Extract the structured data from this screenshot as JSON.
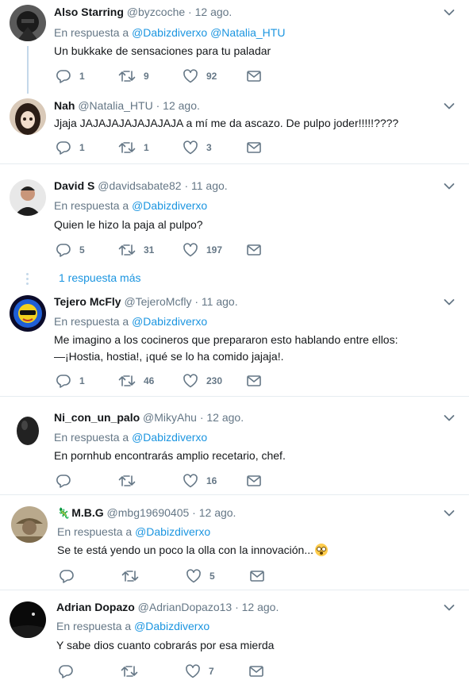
{
  "reply_prefix": "En respuesta a",
  "tweets": [
    {
      "name": "Also Starring",
      "handle": "@byzcoche",
      "time": "12 ago.",
      "reply_to": [
        "@Dabizdiverxo",
        "@Natalia_HTU"
      ],
      "text": "Un bukkake de sensaciones para tu paladar",
      "replies": "1",
      "retweets": "9",
      "likes": "92"
    },
    {
      "name": "Nah",
      "handle": "@Natalia_HTU",
      "time": "12 ago.",
      "text": "Jjaja JAJAJAJAJAJAJAJA a mí me da ascazo. De pulpo joder!!!!!????",
      "replies": "1",
      "retweets": "1",
      "likes": "3"
    },
    {
      "name": "David S",
      "handle": "@davidsabate82",
      "time": "11 ago.",
      "reply_to": [
        "@Dabizdiverxo"
      ],
      "text": "Quien le hizo la paja al pulpo?",
      "replies": "5",
      "retweets": "31",
      "likes": "197",
      "more_replies": "1 respuesta más"
    },
    {
      "name": "Tejero McFly",
      "handle": "@TejeroMcfly",
      "time": "11 ago.",
      "reply_to": [
        "@Dabizdiverxo"
      ],
      "text_line1": "Me imagino a los cocineros que prepararon esto hablando entre ellos:",
      "text_line2": "—¡Hostia, hostia!, ¡qué se lo ha comido jajaja!.",
      "replies": "1",
      "retweets": "46",
      "likes": "230"
    },
    {
      "name": "Ni_con_un_palo",
      "handle": "@MikyAhu",
      "time": "12 ago.",
      "reply_to": [
        "@Dabizdiverxo"
      ],
      "text": "En pornhub encontrarás amplio recetario, chef.",
      "replies": "",
      "retweets": "",
      "likes": "16"
    },
    {
      "name": "M.B.G",
      "handle": "@mbg19690405",
      "time": "12 ago.",
      "reply_to": [
        "@Dabizdiverxo"
      ],
      "text": "Se te está yendo un poco la olla con la innovación...",
      "emoji": "flushed-face",
      "replies": "",
      "retweets": "",
      "likes": "5"
    },
    {
      "name": "Adrian Dopazo",
      "handle": "@AdrianDopazo13",
      "time": "12 ago.",
      "reply_to": [
        "@Dabizdiverxo"
      ],
      "text": "Y sabe dios cuanto cobrarás por esa mierda",
      "replies": "",
      "retweets": "",
      "likes": "7"
    }
  ],
  "colors": {
    "link": "#1b95e0",
    "muted": "#657786",
    "thread_line": "#c4d8ea",
    "separator": "#e6ecf0"
  }
}
